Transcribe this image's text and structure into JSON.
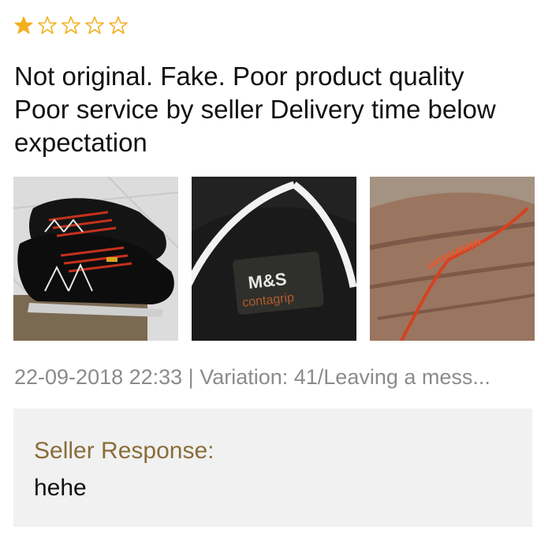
{
  "rating": {
    "value": 1,
    "max": 5,
    "filled_color": "#f2b01e",
    "empty_color": "#f2b01e",
    "icons": [
      "star-filled-icon",
      "star-empty-icon",
      "star-empty-icon",
      "star-empty-icon",
      "star-empty-icon"
    ]
  },
  "review": {
    "text": "Not original. Fake. Poor product quality\nPoor service by seller  Delivery time below\nexpectation"
  },
  "photos": {
    "photo_1_desc": "black sneakers with red laces on tiled floor",
    "photo_2_label_top": "M&S",
    "photo_2_label_bottom": "contagrip",
    "photo_3_desc": "broken red shoelace in hand"
  },
  "meta": {
    "line": "22-09-2018 22:33 | Variation: 41/Leaving a mess..."
  },
  "seller_response": {
    "title": "Seller Response:",
    "reply": "hehe",
    "title_color": "#8a6d3b"
  }
}
